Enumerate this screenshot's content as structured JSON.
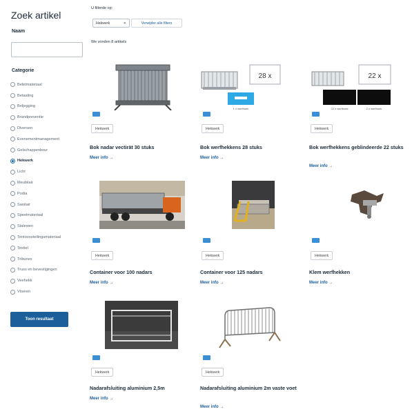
{
  "sidebar": {
    "title": "Zoek artikel",
    "name_label": "Naam",
    "name_value": "",
    "category_label": "Categorie",
    "categories": [
      {
        "label": "Beletmateriaal",
        "selected": false
      },
      {
        "label": "Betaaling",
        "selected": false
      },
      {
        "label": "Beljegging",
        "selected": false
      },
      {
        "label": "Brandpreventie",
        "selected": false
      },
      {
        "label": "Diversen",
        "selected": false
      },
      {
        "label": "Evenementmanagement",
        "selected": false
      },
      {
        "label": "Gelschappenbour",
        "selected": false
      },
      {
        "label": "Hekwerk",
        "selected": true
      },
      {
        "label": "Licht",
        "selected": false
      },
      {
        "label": "Meubilair",
        "selected": false
      },
      {
        "label": "Podia",
        "selected": false
      },
      {
        "label": "Sanitair",
        "selected": false
      },
      {
        "label": "Speelmateriaal",
        "selected": false
      },
      {
        "label": "Stalewen",
        "selected": false
      },
      {
        "label": "Tentoonstellingsmateriaal",
        "selected": false
      },
      {
        "label": "Textiel",
        "selected": false
      },
      {
        "label": "Tribunes",
        "selected": false
      },
      {
        "label": "Truss en bevestigingen",
        "selected": false
      },
      {
        "label": "Veehekk",
        "selected": false
      },
      {
        "label": "Vloeren",
        "selected": false
      }
    ],
    "show_button": "Toon resultaat"
  },
  "filters": {
    "label": "U filterde op:",
    "active": [
      {
        "label": "Hekwerk",
        "close": "✕"
      }
    ],
    "clear_label": "Verwijder alle filters"
  },
  "results": {
    "count_label": "We vonden 8 artikels"
  },
  "products": [
    {
      "title": "Bok nadar vectirät 30 stuks",
      "category": "Hekwerk",
      "more": "Meer info →",
      "image": "stacked-fence-panels"
    },
    {
      "title": "Bok werfhekkens 28 stuks",
      "category": "Hekwerk",
      "more": "Meer info →",
      "image": "fence-pallet-28x",
      "qty_badge": "28 x",
      "caption": "1 x werfhoek"
    },
    {
      "title": "Bok werfhekkens geblindeerde 22 stuks",
      "category": "Hekwerk",
      "more": "Meer info →",
      "image": "fence-pallet-22x",
      "qty_badge": "22 x",
      "caption_left": "22 x werfhoek",
      "caption_right": "2 x werfhoek"
    },
    {
      "title": "Container voor 100 nadars",
      "category": "Hekwerk",
      "more": "Meer info →",
      "image": "truck-container"
    },
    {
      "title": "Container voor 125 nadars",
      "category": "Hekwerk",
      "more": "Meer info →",
      "image": "yellow-rack"
    },
    {
      "title": "Klem werfhekken",
      "category": "Hekwerk",
      "more": "Meer info →",
      "image": "clamp"
    },
    {
      "title": "Nadarafsluiting aluminium 2,5m",
      "category": "Hekwerk",
      "more": "Meer info →",
      "image": "aluminium-gate"
    },
    {
      "title": "Nadarafsluiting aluminium 2m vaste voet",
      "category": "Hekwerk",
      "more": "Meer info →",
      "image": "crowd-barrier"
    }
  ],
  "colors": {
    "primary": "#1c5f9a",
    "badge": "#3a8fd6",
    "text": "#1d2b3a"
  }
}
